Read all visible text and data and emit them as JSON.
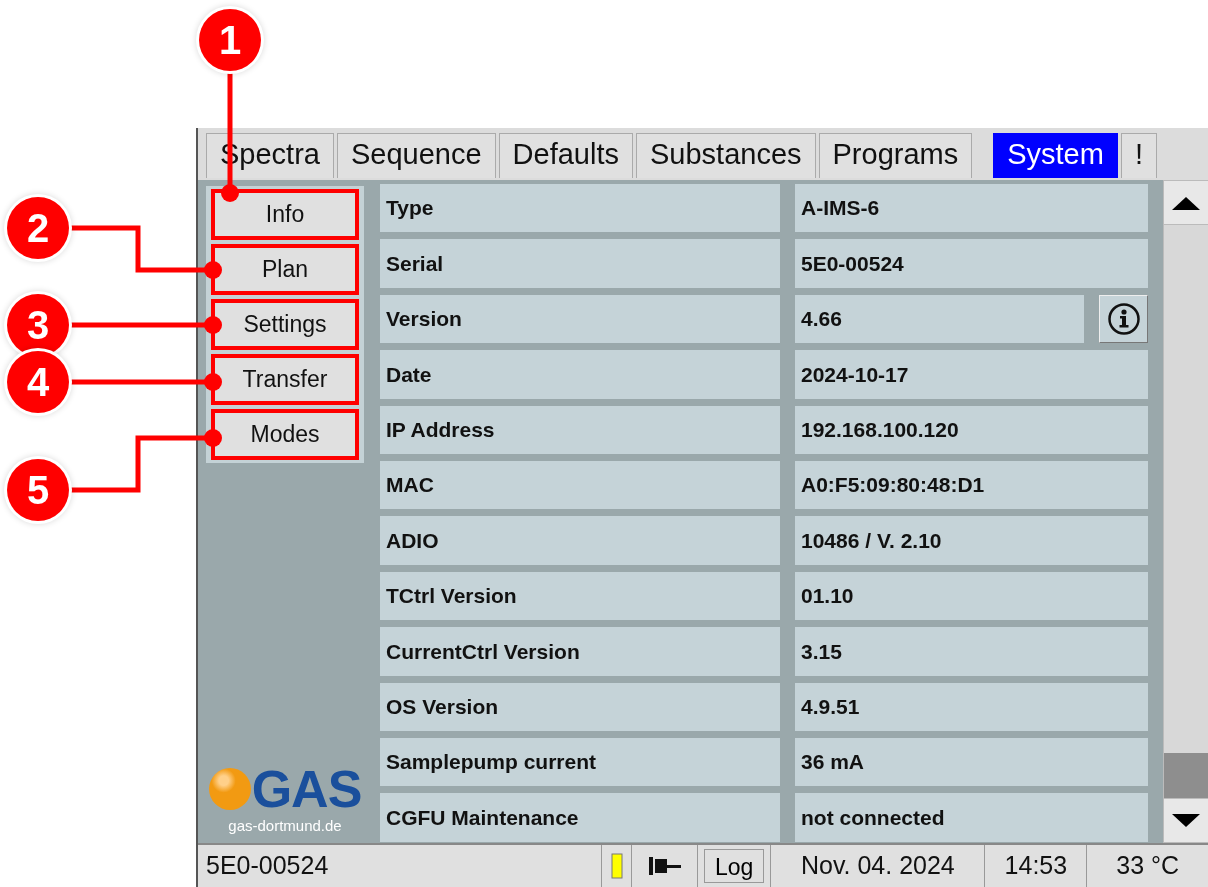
{
  "tabs": [
    {
      "label": "Spectra",
      "selected": false
    },
    {
      "label": "Sequence",
      "selected": false
    },
    {
      "label": "Defaults",
      "selected": false
    },
    {
      "label": "Substances",
      "selected": false
    },
    {
      "label": "Programs",
      "selected": false
    },
    {
      "label": "System",
      "selected": true
    },
    {
      "label": "!",
      "selected": false
    }
  ],
  "sidebar": {
    "items": [
      {
        "label": "Info",
        "highlighted": true
      },
      {
        "label": "Plan",
        "highlighted": true
      },
      {
        "label": "Settings",
        "highlighted": true
      },
      {
        "label": "Transfer",
        "highlighted": true
      },
      {
        "label": "Modes",
        "highlighted": true
      }
    ]
  },
  "logo": {
    "text": "GAS",
    "url": "gas-dortmund.de"
  },
  "info_table": {
    "rows": [
      {
        "label": "Type",
        "value": "A-IMS-6",
        "kind": "text"
      },
      {
        "label": "Serial",
        "value": "5E0-00524",
        "kind": "text"
      },
      {
        "label": "Version",
        "value": "4.66",
        "kind": "info"
      },
      {
        "label": "Date",
        "value": "2024-10-17",
        "kind": "text"
      },
      {
        "label": "IP Address",
        "value": "192.168.100.120",
        "kind": "text"
      },
      {
        "label": "MAC",
        "value": "A0:F5:09:80:48:D1",
        "kind": "text"
      },
      {
        "label": "ADIO",
        "value": "10486 / V. 2.10",
        "kind": "text"
      },
      {
        "label": "TCtrl Version",
        "value": "01.10",
        "kind": "text"
      },
      {
        "label": "CurrentCtrl Version",
        "value": "3.15",
        "kind": "text"
      },
      {
        "label": "OS Version",
        "value": "4.9.51",
        "kind": "text"
      },
      {
        "label": "Samplepump current",
        "value": "36 mA",
        "kind": "text"
      },
      {
        "label": "CGFU Maintenance",
        "value": "not connected",
        "kind": "text"
      }
    ]
  },
  "status_bar": {
    "serial": "5E0-00524",
    "log_button": "Log",
    "date": "Nov. 04. 2024",
    "time": "14:53",
    "temperature": "33 °C"
  },
  "annotations": [
    {
      "label": "1"
    },
    {
      "label": "2"
    },
    {
      "label": "3"
    },
    {
      "label": "4"
    },
    {
      "label": "5"
    }
  ]
}
